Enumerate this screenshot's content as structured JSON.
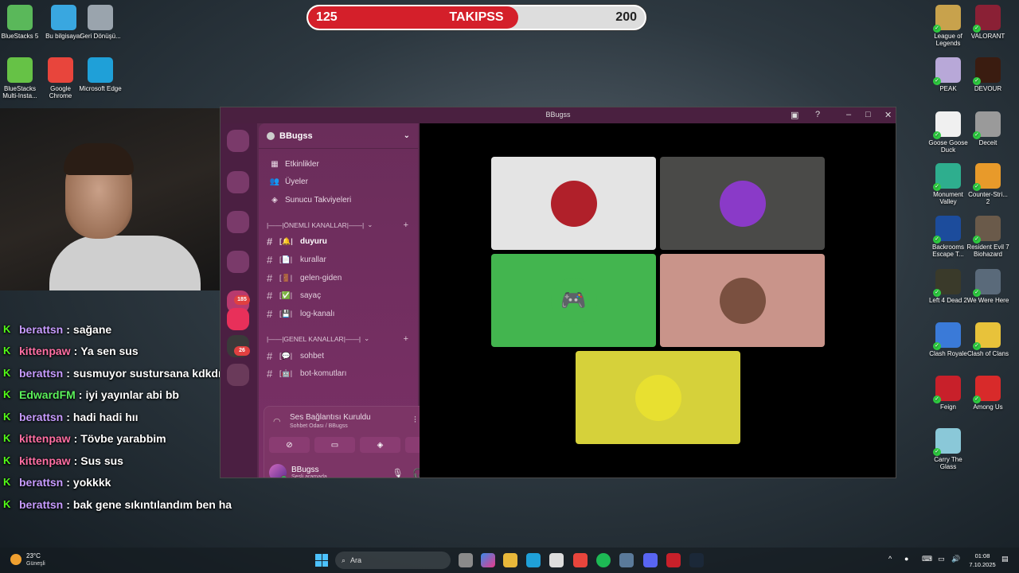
{
  "follower_goal": {
    "current": "125",
    "label": "TAKIPSS",
    "goal": "200",
    "progress_fraction": 0.625,
    "fill_color": "#d41f2a"
  },
  "desktop_left": [
    {
      "label": "BlueStacks 5",
      "icon": "bluestacks-icon",
      "color": "#5ab85a"
    },
    {
      "label": "Bu bilgisayar",
      "icon": "computer-icon",
      "color": "#39a7e0"
    },
    {
      "label": "Geri Dönüşü...",
      "icon": "recycle-bin-icon",
      "color": "#9aa4ad"
    },
    {
      "label": "BlueStacks Multi-Insta...",
      "icon": "bluestacks-multi-icon",
      "color": "#66c246"
    },
    {
      "label": "Google Chrome",
      "icon": "chrome-icon",
      "color": "#e8453c"
    },
    {
      "label": "Microsoft Edge",
      "icon": "edge-icon",
      "color": "#1fa0d8"
    }
  ],
  "desktop_right": [
    {
      "label": "League of Legends",
      "icon": "league-icon",
      "color": "#c8a24c"
    },
    {
      "label": "VALORANT",
      "icon": "valorant-icon",
      "color": "#8a2035"
    },
    {
      "label": "PEAK",
      "icon": "peak-icon",
      "color": "#b8a8d8"
    },
    {
      "label": "DEVOUR",
      "icon": "devour-icon",
      "color": "#3a1c10"
    },
    {
      "label": "Goose Goose Duck",
      "icon": "goose-icon",
      "color": "#f0f0f0"
    },
    {
      "label": "Deceit",
      "icon": "deceit-icon",
      "color": "#9a9a9a"
    },
    {
      "label": "Monument Valley",
      "icon": "monument-icon",
      "color": "#2eae8e"
    },
    {
      "label": "Counter-Stri... 2",
      "icon": "cs2-icon",
      "color": "#e89a2a"
    },
    {
      "label": "Backrooms Escape T...",
      "icon": "backrooms-icon",
      "color": "#1c4c9c"
    },
    {
      "label": "Resident Evil 7 Biohazard",
      "icon": "re7-icon",
      "color": "#6a5a4a"
    },
    {
      "label": "Left 4 Dead 2",
      "icon": "l4d2-icon",
      "color": "#3a3a2a"
    },
    {
      "label": "We Were Here",
      "icon": "wewerehere-icon",
      "color": "#5a6a7a"
    },
    {
      "label": "Clash Royale",
      "icon": "clash-royale-icon",
      "color": "#3a7ad8"
    },
    {
      "label": "Clash of Clans",
      "icon": "coc-icon",
      "color": "#e8c23a"
    },
    {
      "label": "Feign",
      "icon": "feign-icon",
      "color": "#c8202a"
    },
    {
      "label": "Among Us",
      "icon": "among-us-icon",
      "color": "#d82a2a"
    },
    {
      "label": "Carry The Glass",
      "icon": "carry-glass-icon",
      "color": "#8ac8d8"
    }
  ],
  "chat": [
    {
      "user": "berattsn",
      "color": "#c79cff",
      "msg": "sağane"
    },
    {
      "user": "kittenpaw",
      "color": "#ff6fa3",
      "msg": "Ya sen sus"
    },
    {
      "user": "berattsn",
      "color": "#c79cff",
      "msg": "susmuyor sustursana kdkdmdnd"
    },
    {
      "user": "EdwardFM",
      "color": "#5bf05b",
      "msg": "iyi yayınlar abi bb"
    },
    {
      "user": "berattsn",
      "color": "#c79cff",
      "msg": "hadi hadi hıı"
    },
    {
      "user": "kittenpaw",
      "color": "#ff6fa3",
      "msg": "Tövbe yarabbim"
    },
    {
      "user": "kittenpaw",
      "color": "#ff6fa3",
      "msg": "Sus sus"
    },
    {
      "user": "berattsn",
      "color": "#c79cff",
      "msg": "yokkkk"
    },
    {
      "user": "berattsn",
      "color": "#c79cff",
      "msg": "bak gene sıkıntılandım ben ha"
    }
  ],
  "chat_badge": "K",
  "chat_separator": ":",
  "discord": {
    "window_title": "BBugss",
    "server_name": "BBugss",
    "menu": [
      {
        "label": "Etkinlikler",
        "icon": "calendar-icon"
      },
      {
        "label": "Üyeler",
        "icon": "members-icon"
      },
      {
        "label": "Sunucu Takviyeleri",
        "icon": "boost-icon"
      }
    ],
    "categories": [
      {
        "label": "|——|ÖNEMLİ KANALLAR|——|",
        "channels": [
          {
            "emoji": "[🔔|",
            "name": "duyuru",
            "active": true
          },
          {
            "emoji": "[📄|",
            "name": "kurallar",
            "active": false
          },
          {
            "emoji": "[🚪|",
            "name": "gelen-giden",
            "active": false
          },
          {
            "emoji": "[✅|",
            "name": "sayaç",
            "active": false
          },
          {
            "emoji": "[💾|",
            "name": "log-kanalı",
            "active": false
          }
        ]
      },
      {
        "label": "|——|GENEL KANALLAR|——|",
        "channels": [
          {
            "emoji": "[💬|",
            "name": "sohbet",
            "active": false
          },
          {
            "emoji": "[🤖|",
            "name": "bot-komutları",
            "active": false
          }
        ]
      }
    ],
    "rail_badges": [
      "185",
      "26"
    ],
    "voice": {
      "status": "Ses Bağlantısı Kuruldu",
      "channel": "Sohbet Odası / BBugss"
    },
    "user": {
      "name": "BBugss",
      "state": "Sesli aramada"
    },
    "tiles": [
      {
        "bg": "#e4e4e4",
        "avatar": "anime-avatar",
        "av_color": "#b0202a"
      },
      {
        "bg": "#4a4a48",
        "avatar": "purple-avatar",
        "av_color": "#8a3ac8"
      },
      {
        "bg": "#43b54f",
        "avatar": "discord-logo-avatar",
        "av_color": "#43b54f"
      },
      {
        "bg": "#c9948a",
        "avatar": "man-avatar",
        "av_color": "#7a5040"
      },
      {
        "bg": "#d6d13a",
        "avatar": "sunglasses-avatar",
        "av_color": "#e8e030"
      }
    ]
  },
  "taskbar": {
    "temp": "23°C",
    "weather": "Güneşli",
    "search_placeholder": "Ara",
    "time": "01:08",
    "date": "7.10.2025"
  }
}
